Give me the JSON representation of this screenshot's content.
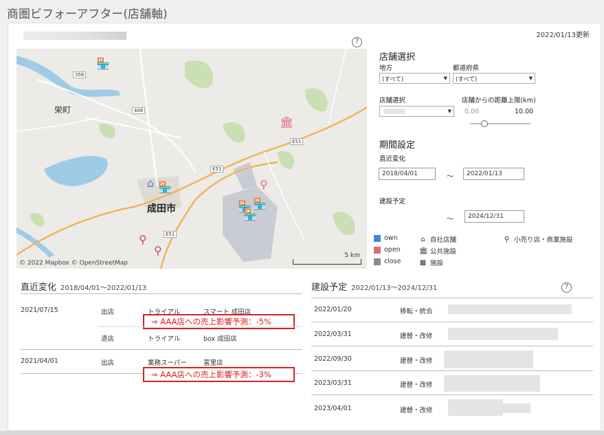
{
  "page": {
    "title": "商圏ビフォーアフター(店舗軸)",
    "updated": "2022/01/13更新",
    "help": "?"
  },
  "map": {
    "labels": {
      "sakaemachi": "栄町",
      "narita": "成田市"
    },
    "roads": [
      "356",
      "408",
      "E51",
      "E51",
      "E51"
    ],
    "credit": "© 2022 Mapbox © OpenStreetMap",
    "scale": "5 km"
  },
  "store_select": {
    "heading": "店舗選択",
    "region_label": "地方",
    "region_value": "(すべて)",
    "pref_label": "都道府県",
    "pref_value": "(すべて)",
    "store_label": "店舗選択",
    "distance_label": "店舗からの距離上限(km)",
    "distance_min": "0.00",
    "distance_max": "10.00"
  },
  "period": {
    "heading": "期間設定",
    "recent_label": "直近変化",
    "recent_from": "2018/04/01",
    "recent_to": "2022/01/13",
    "plan_label": "建設予定",
    "plan_to": "2024/12/31",
    "tilde": "～"
  },
  "legend": {
    "own": "own",
    "open": "open",
    "close": "close",
    "own_store": "自社店舗",
    "public": "公共施設",
    "facility": "施設",
    "retail": "小売り店・商業施設",
    "colors": {
      "own": "#3f87d6",
      "open": "#e2687a",
      "close": "#8c8c8c"
    }
  },
  "recent_table": {
    "title": "直近変化",
    "period": "2018/04/01～2022/01/13",
    "rows": [
      {
        "date": "2021/07/15",
        "type": "出店",
        "brand": "トライアル",
        "store": "スマート 成田店",
        "impact": "⇒ AAA店への売上影響予測：-5%"
      },
      {
        "date": "",
        "type": "退店",
        "brand": "トライアル",
        "store": "box 成田店"
      },
      {
        "date": "2021/04/01",
        "type": "出店",
        "brand": "業務スーパー",
        "store": "富里店",
        "impact": "⇒ AAA店への売上影響予測：-3%"
      }
    ]
  },
  "plan_table": {
    "title": "建設予定",
    "period": "2022/01/13～2024/12/31",
    "rows": [
      {
        "date": "2022/01/20",
        "type": "移転・統合"
      },
      {
        "date": "2022/03/31",
        "type": "建替・改修"
      },
      {
        "date": "2022/09/30",
        "type": "建替・改修"
      },
      {
        "date": "2023/03/31",
        "type": "建替・改修"
      },
      {
        "date": "2023/04/01",
        "type": "建替・改修"
      }
    ]
  }
}
